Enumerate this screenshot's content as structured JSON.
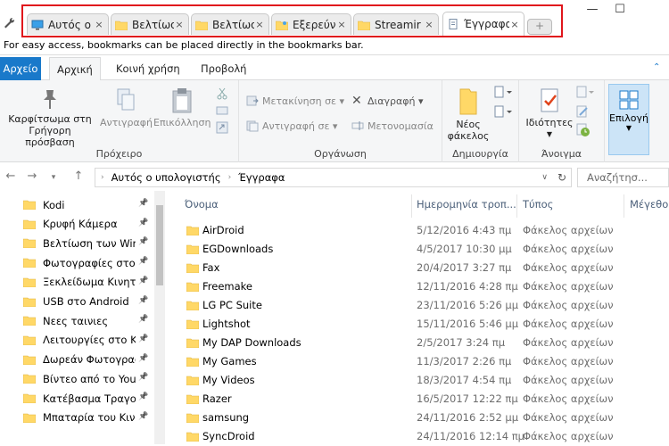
{
  "tabs": [
    {
      "label": "Αυτός ο",
      "icon": "computer-icon"
    },
    {
      "label": "Βελτίωσ",
      "icon": "folder-icon"
    },
    {
      "label": "Βελτίωσ",
      "icon": "folder-icon"
    },
    {
      "label": "Εξερεύνη",
      "icon": "folder-star-icon"
    },
    {
      "label": "Streamir",
      "icon": "folder-icon"
    },
    {
      "label": "Έγγραφα",
      "icon": "document-icon",
      "active": true
    }
  ],
  "tab_close": "×",
  "new_tab": "+",
  "window_controls": {
    "minimize": "—",
    "maximize": "☐"
  },
  "bookmarks_bar": {
    "message": "For easy access, bookmarks can be placed directly in the bookmarks bar."
  },
  "ribbon_tabs": {
    "file": "Αρχείο",
    "home": "Αρχική",
    "share": "Κοινή χρήση",
    "view": "Προβολή"
  },
  "ribbon": {
    "clipboard": {
      "group_label": "Πρόχειρο",
      "pin_line1": "Καρφίτσωμα στη",
      "pin_line2": "Γρήγορη πρόσβαση",
      "copy": "Αντιγραφή",
      "paste": "Επικόλληση"
    },
    "organize": {
      "group_label": "Οργάνωση",
      "move_to": "Μετακίνηση σε",
      "copy_to": "Αντιγραφή σε",
      "delete": "Διαγραφή",
      "rename": "Μετονομασία"
    },
    "new": {
      "group_label": "Δημιουργία",
      "new_folder_line1": "Νέος",
      "new_folder_line2": "φάκελος"
    },
    "open": {
      "group_label": "Άνοιγμα",
      "properties": "Ιδιότητες"
    },
    "select": {
      "label": "Επιλογή"
    }
  },
  "address": {
    "path": [
      "Αυτός ο υπολογιστής",
      "Έγγραφα"
    ],
    "search_placeholder": "Αναζήτησ..."
  },
  "nav_items": [
    "Kodi",
    "Κρυφή Κάμερα",
    "Βελτίωση των Win",
    "Φωτογραφίες στο",
    "Ξεκλείδωμα Κινητο",
    "USB στο Android",
    "Νεες ταινιες",
    "Λειτουργίες στο Κιν",
    "Δωρεάν Φωτογραφ",
    "Βίντεο από το YouT",
    "Κατέβασμα Τραγου",
    "Μπαταρία του Κινη"
  ],
  "columns": {
    "name": "Όνομα",
    "date": "Ημερομηνία τροπ...",
    "type": "Τύπος",
    "size": "Μέγεθο"
  },
  "files": [
    {
      "name": "AirDroid",
      "date": "5/12/2016 4:43 πμ",
      "type": "Φάκελος αρχείων"
    },
    {
      "name": "EGDownloads",
      "date": "4/5/2017 10:30 μμ",
      "type": "Φάκελος αρχείων"
    },
    {
      "name": "Fax",
      "date": "20/4/2017 3:27 πμ",
      "type": "Φάκελος αρχείων"
    },
    {
      "name": "Freemake",
      "date": "12/11/2016 4:28 πμ",
      "type": "Φάκελος αρχείων"
    },
    {
      "name": "LG PC Suite",
      "date": "23/11/2016 5:26 μμ",
      "type": "Φάκελος αρχείων"
    },
    {
      "name": "Lightshot",
      "date": "15/11/2016 5:46 μμ",
      "type": "Φάκελος αρχείων"
    },
    {
      "name": "My DAP Downloads",
      "date": "2/5/2017 3:24 πμ",
      "type": "Φάκελος αρχείων"
    },
    {
      "name": "My Games",
      "date": "11/3/2017 2:26 πμ",
      "type": "Φάκελος αρχείων"
    },
    {
      "name": "My Videos",
      "date": "18/3/2017 4:54 πμ",
      "type": "Φάκελος αρχείων"
    },
    {
      "name": "Razer",
      "date": "16/5/2017 12:22 πμ",
      "type": "Φάκελος αρχείων"
    },
    {
      "name": "samsung",
      "date": "24/11/2016 2:52 μμ",
      "type": "Φάκελος αρχείων"
    },
    {
      "name": "SyncDroid",
      "date": "24/11/2016 12:14 πμ",
      "type": "Φάκελος αρχείων"
    }
  ],
  "colors": {
    "accent": "#1979ca",
    "highlight_border": "#e0161c",
    "folder": "#ffd867"
  }
}
